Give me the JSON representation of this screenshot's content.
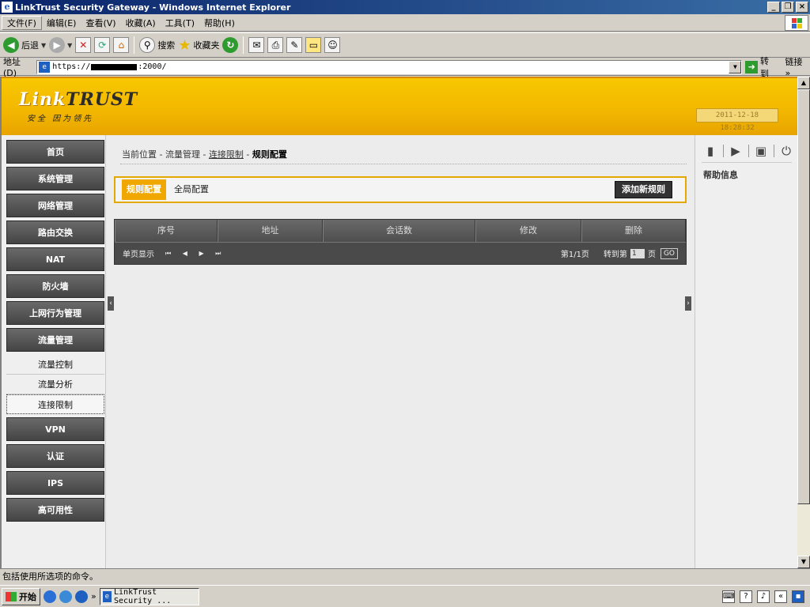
{
  "window": {
    "title": "LinkTrust Security Gateway - Windows Internet Explorer"
  },
  "menubar": {
    "items": [
      "文件(F)",
      "编辑(E)",
      "查看(V)",
      "收藏(A)",
      "工具(T)",
      "帮助(H)"
    ]
  },
  "toolbar": {
    "back_label": "后退",
    "search_label": "搜索",
    "favorites_label": "收藏夹"
  },
  "address": {
    "label": "地址(D)",
    "url_prefix": "https://",
    "url_suffix": ":2000/",
    "go_label": "转到",
    "links_label": "链接 »"
  },
  "header": {
    "logo_part1": "Link",
    "logo_part2": "TRUST",
    "slogan": "安全 因为领先",
    "datetime": "2011-12-18 18:28:32"
  },
  "nav": {
    "items": [
      "首页",
      "系统管理",
      "网络管理",
      "路由交换",
      "NAT",
      "防火墙",
      "上网行为管理",
      "流量管理",
      "VPN",
      "认证",
      "IPS",
      "高可用性"
    ],
    "sub_items": [
      "流量控制",
      "流量分析",
      "连接限制"
    ]
  },
  "breadcrumb": {
    "prefix": "当前位置 - ",
    "level1": "流量管理",
    "sep": " - ",
    "level2": "连接限制",
    "current": "规则配置"
  },
  "tabs": {
    "active": "规则配置",
    "other": "全局配置",
    "add_button": "添加新规则"
  },
  "grid": {
    "columns": [
      "序号",
      "地址",
      "会话数",
      "修改",
      "删除"
    ],
    "footer_left": "单页显示",
    "pager_controls": "⏮ ◀ ▶ ⏭",
    "page_info": "第1/1页",
    "goto_label": "转到第",
    "page_value": "1",
    "page_unit": "页",
    "go_label": "GO"
  },
  "rightpanel": {
    "help_title": "帮助信息"
  },
  "statusbar": {
    "text": "包括使用所选项的命令。"
  },
  "taskbar": {
    "start_label": "开始",
    "task_label": "LinkTrust Security ..."
  },
  "colors": {
    "header_yellow": "#f2b600",
    "active_tab": "#f0a800",
    "nav_dark": "#555555"
  }
}
